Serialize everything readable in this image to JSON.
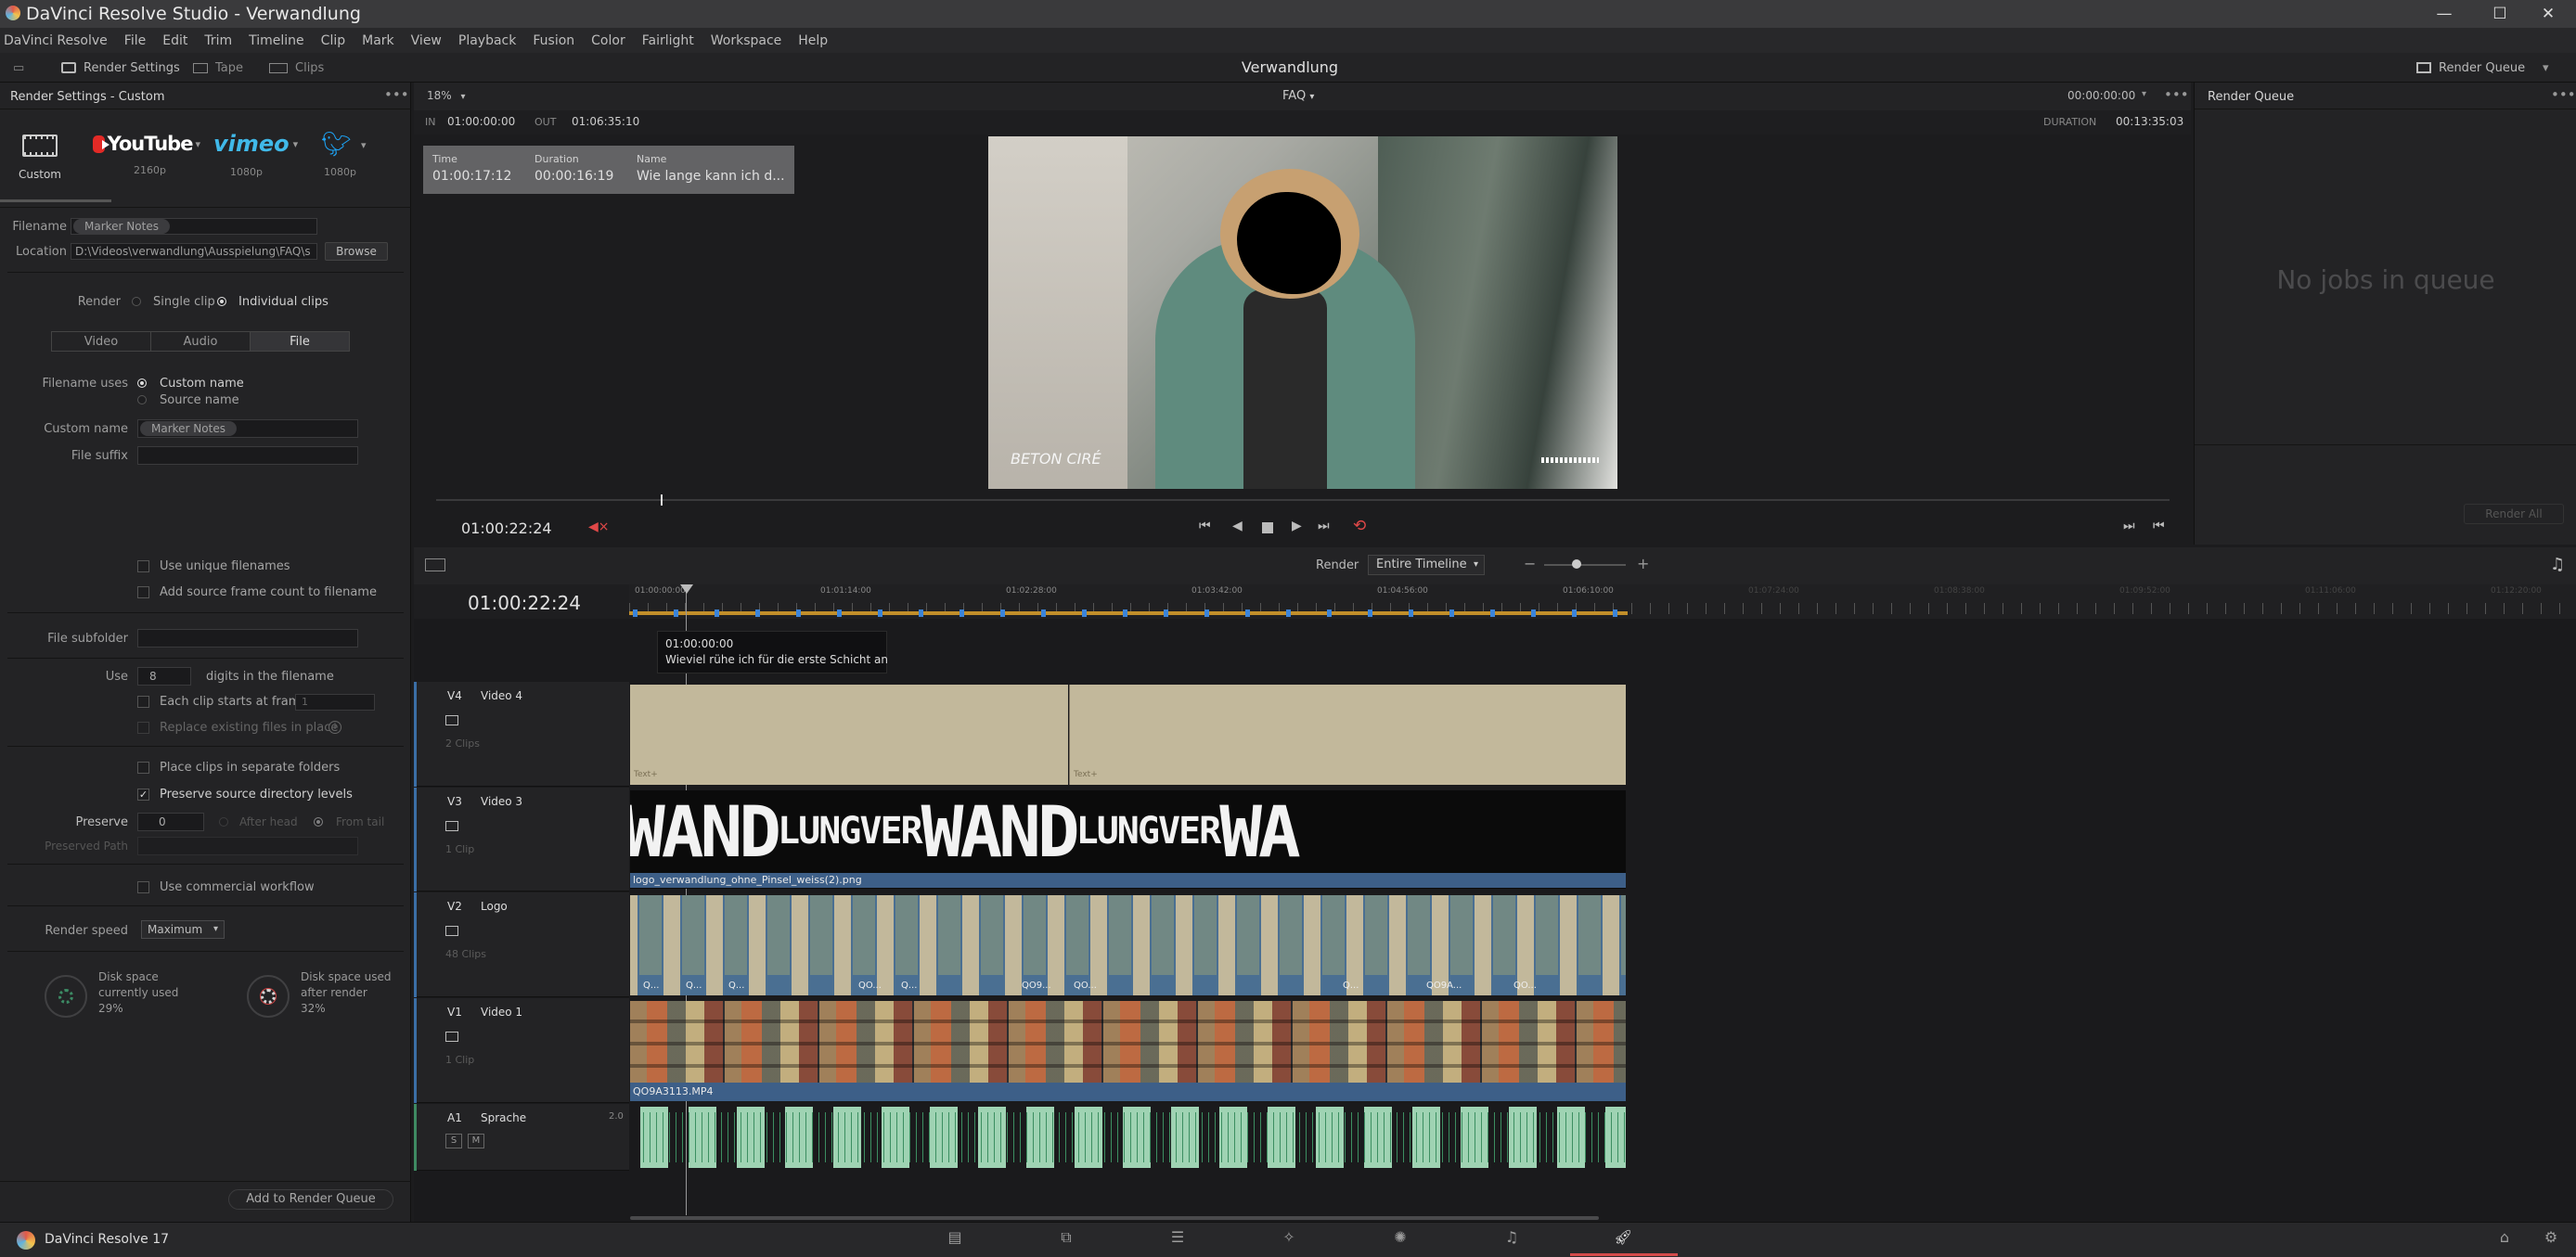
{
  "window": {
    "title": "DaVinci Resolve Studio - Verwandlung",
    "controls": [
      "—",
      "☐",
      "✕"
    ]
  },
  "menu": [
    "DaVinci Resolve",
    "File",
    "Edit",
    "Trim",
    "Timeline",
    "Clip",
    "Mark",
    "View",
    "Playback",
    "Fusion",
    "Color",
    "Fairlight",
    "Workspace",
    "Help"
  ],
  "toolbar": {
    "render_settings": "Render Settings",
    "tape": "Tape",
    "clips": "Clips",
    "project_name": "Verwandlung",
    "render_queue": "Render Queue"
  },
  "render_settings": {
    "header": "Render Settings - Custom",
    "presets": [
      {
        "label": "Custom",
        "sub": ""
      },
      {
        "label": "YouTube",
        "sub": "2160p"
      },
      {
        "label": "vimeo",
        "sub": "1080p"
      },
      {
        "label": "twitter",
        "sub": "1080p"
      }
    ],
    "filename_label": "Filename",
    "filename_value": "Marker Notes",
    "location_label": "Location",
    "location_value": "D:\\Videos\\verwandlung\\Ausspielung\\FAQ\\s",
    "browse": "Browse",
    "render_label": "Render",
    "single_clip": "Single clip",
    "individual_clips": "Individual clips",
    "tabs": [
      "Video",
      "Audio",
      "File"
    ],
    "filename_uses_label": "Filename uses",
    "custom_name_opt": "Custom name",
    "source_name_opt": "Source name",
    "custom_name_label": "Custom name",
    "custom_name_value": "Marker Notes",
    "file_suffix_label": "File suffix",
    "use_unique": "Use unique filenames",
    "add_source_frame": "Add source frame count to filename",
    "file_subfolder_label": "File subfolder",
    "use_label": "Use",
    "digits_value": "8",
    "digits_text": "digits in the filename",
    "each_clip": "Each clip starts at frame",
    "each_clip_value": "1",
    "replace_existing": "Replace existing files in place",
    "place_clips": "Place clips in separate folders",
    "preserve_source": "Preserve source directory levels",
    "preserve_label": "Preserve",
    "preserve_value": "0",
    "after_head": "After head",
    "from_tail": "From tail",
    "preserved_path": "Preserved Path",
    "use_commercial": "Use commercial workflow",
    "render_speed_label": "Render speed",
    "render_speed_value": "Maximum",
    "disk_current_1": "Disk space",
    "disk_current_2": "currently used",
    "disk_current_pct": "29%",
    "disk_after_1": "Disk space used",
    "disk_after_2": "after render",
    "disk_after_pct": "32%",
    "add_to_queue": "Add to Render Queue"
  },
  "viewer": {
    "zoom": "18%",
    "timeline_name": "FAQ",
    "timecode_top": "00:00:00:00",
    "in_label": "IN",
    "in_value": "01:00:00:00",
    "out_label": "OUT",
    "out_value": "01:06:35:10",
    "duration_label": "DURATION",
    "duration_value": "00:13:35:03",
    "marker_time_label": "Time",
    "marker_time": "01:00:17:12",
    "marker_duration_label": "Duration",
    "marker_duration": "00:00:16:19",
    "marker_name_label": "Name",
    "marker_name": "Wie lange kann ich d...",
    "overlay_text": "BETON CIRÉ",
    "playhead_tc": "01:00:22:24"
  },
  "render_queue": {
    "title": "Render Queue",
    "empty": "No jobs in queue",
    "render_all": "Render All"
  },
  "timeline": {
    "render_label": "Render",
    "render_range": "Entire Timeline",
    "timecode": "01:00:22:24",
    "ruler": [
      "01:00:00:00",
      "01:01:14:00",
      "01:02:28:00",
      "01:03:42:00",
      "01:04:56:00",
      "01:06:10:00",
      "01:07:24:00",
      "01:08:38:00",
      "01:09:52:00",
      "01:11:06:00",
      "01:12:20:00"
    ],
    "tooltip_tc": "01:00:00:00",
    "tooltip_text": "Wieviel rühe ich für die erste Schicht an",
    "tracks": [
      {
        "id": "V4",
        "name": "Video 4",
        "count": "2 Clips",
        "clip_labels": [
          "Text+",
          "Text+"
        ]
      },
      {
        "id": "V3",
        "name": "Video 3",
        "count": "1 Clip",
        "clip_labels": [
          "logo_verwandlung_ohne_Pinsel_weiss(2).png"
        ],
        "logo_words": [
          "WAND",
          "LUNGVER",
          "WAND",
          "LUNGVER",
          "WA"
        ]
      },
      {
        "id": "V2",
        "name": "Logo",
        "count": "48 Clips",
        "clip_labels": [
          "Q...",
          "Q...",
          "Q...",
          "QO...",
          "Q...",
          "QO9...",
          "QO...",
          "Q...",
          "QO9A...",
          "QO..."
        ]
      },
      {
        "id": "V1",
        "name": "Video 1",
        "count": "1 Clip",
        "clip_labels": [
          "QO9A3113.MP4"
        ]
      },
      {
        "id": "A1",
        "name": "Sprache",
        "count": "2.0",
        "buttons": [
          "S",
          "M"
        ]
      }
    ]
  },
  "bottom": {
    "app_version": "DaVinci Resolve 17"
  }
}
